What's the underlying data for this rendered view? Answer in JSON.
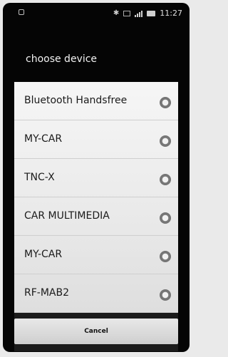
{
  "status_bar": {
    "time": "11:27",
    "icons": [
      "bluetooth-icon",
      "vibrate-icon",
      "signal-icon",
      "battery-icon"
    ]
  },
  "dialog": {
    "title": "choose device",
    "devices": [
      {
        "label": "Bluetooth Handsfree"
      },
      {
        "label": "MY-CAR"
      },
      {
        "label": "TNC-X"
      },
      {
        "label": "CAR MULTIMEDIA"
      },
      {
        "label": "MY-CAR"
      },
      {
        "label": "RF-MAB2"
      }
    ],
    "cancel_label": "Cancel"
  }
}
